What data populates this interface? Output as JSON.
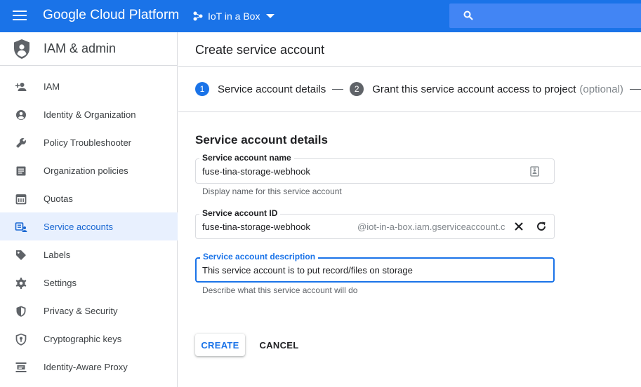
{
  "topbar": {
    "brand": "Google Cloud Platform",
    "project_name": "IoT in a Box",
    "accent_color": "#1a73e8",
    "icons": [
      "menu-icon",
      "project-icon",
      "chevron-down-icon",
      "search-icon"
    ]
  },
  "sidebar": {
    "title": "IAM & admin",
    "items": [
      {
        "label": "IAM",
        "icon": "person-add-icon"
      },
      {
        "label": "Identity & Organization",
        "icon": "account-circle-icon"
      },
      {
        "label": "Policy Troubleshooter",
        "icon": "wrench-icon"
      },
      {
        "label": "Organization policies",
        "icon": "article-icon"
      },
      {
        "label": "Quotas",
        "icon": "calendar-icon"
      },
      {
        "label": "Service accounts",
        "icon": "service-account-icon",
        "active": true
      },
      {
        "label": "Labels",
        "icon": "tag-icon"
      },
      {
        "label": "Settings",
        "icon": "gear-icon"
      },
      {
        "label": "Privacy & Security",
        "icon": "shield-icon"
      },
      {
        "label": "Cryptographic keys",
        "icon": "shield-key-icon"
      },
      {
        "label": "Identity-Aware Proxy",
        "icon": "proxy-icon"
      }
    ]
  },
  "main": {
    "page_title": "Create service account",
    "stepper": {
      "step1": {
        "number": "1",
        "label": "Service account details"
      },
      "step2": {
        "number": "2",
        "label": "Grant this service account access to project",
        "optional": "(optional)"
      }
    },
    "section_title": "Service account details",
    "form": {
      "name": {
        "label": "Service account name",
        "value": "fuse-tina-storage-webhook",
        "hint": "Display name for this service account"
      },
      "id": {
        "label": "Service account ID",
        "value": "fuse-tina-storage-webhook",
        "suffix": "@iot-in-a-box.iam.gserviceaccount.c"
      },
      "description": {
        "label": "Service account description",
        "value": "This service account is to put record/files on storage",
        "hint": "Describe what this service account will do"
      }
    },
    "actions": {
      "create_label": "CREATE",
      "cancel_label": "CANCEL"
    }
  }
}
